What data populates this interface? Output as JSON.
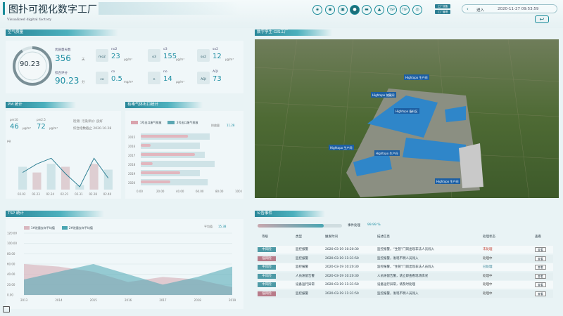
{
  "header": {
    "title": "图扑可视化数字工厂",
    "subtitle": "Visualized digital factory",
    "nav_icons": [
      "shield-icon",
      "camera-icon",
      "image-icon",
      "droplet-icon",
      "truck-icon",
      "factory-icon",
      "tsp-icon",
      "tsp2-icon",
      "layers-icon"
    ],
    "nav_texts": [
      "",
      "",
      "",
      "",
      "",
      "",
      "TSP",
      "TSP",
      ""
    ],
    "pill_top": "工厂设备",
    "pill_bottom": "工厂管理",
    "datebar_label": "进入",
    "datetime": "2020-11-27 09:53:59",
    "back_symbol": "↩"
  },
  "air_quality": {
    "panel_title": "空气质量",
    "gauge_value": "90.23",
    "excellent_days_label": "优质量天数",
    "excellent_days_value": "356",
    "excellent_days_unit": "天",
    "overall_label": "综合评分",
    "overall_value": "90.23",
    "overall_unit": "分",
    "items": [
      {
        "icon": "mo2",
        "name": "no2",
        "value": "23",
        "unit": "μg/m³"
      },
      {
        "icon": "o3",
        "name": "o3",
        "value": "155",
        "unit": "μg/m³"
      },
      {
        "icon": "so2",
        "name": "so2",
        "value": "12",
        "unit": "μg/m³"
      },
      {
        "icon": "co",
        "name": "co",
        "value": "0.5",
        "unit": "mg/m³"
      },
      {
        "icon": "n",
        "name": "no",
        "value": "14",
        "unit": "μg/m³"
      },
      {
        "icon": "AQI",
        "name": "AQI",
        "value": "73",
        "unit": ""
      }
    ]
  },
  "pm": {
    "panel_title": "PM 统计",
    "pm10_label": "pm10",
    "pm10_value": "46",
    "pm10_unit": "μg/m³",
    "pm25_label": "pm2.5",
    "pm25_value": "72",
    "pm25_unit": "μg/m³",
    "desc1": "检测: 污染评价: 良好",
    "desc2": "综合指数截止 2020.10.28",
    "ylabel": "μg"
  },
  "hazard": {
    "panel_title": "有毒气体出口统计",
    "legend1": "1号出口废气排放",
    "legend2": "2号出口废气排放",
    "value_label": "排放量",
    "value": "11.28"
  },
  "gis": {
    "panel_title": "数字孪生-GIS工厂",
    "labels": [
      "Hightopo 生产间",
      "Hightopo 储藏间",
      "Hightopo 备料区",
      "Hightopo 生产间",
      "Hightopo 生产间",
      "Hightopo 生产间"
    ]
  },
  "tsp": {
    "panel_title": "TSP 统计",
    "legend1": "1#进量去年平均值",
    "legend2": "2#进量去年平均值",
    "avg_label": "平均值",
    "avg_value": "15.38"
  },
  "events": {
    "panel_title": "公告事件",
    "progress_label": "事件处理",
    "progress_text": "99.99 %",
    "progress": 0.78,
    "columns": [
      "等级",
      "类型",
      "触发时间",
      "描述信息",
      "处理状态",
      "查看"
    ],
    "rows": [
      {
        "level": "中风险",
        "type": "监控报警",
        "time": "2020-03-19 10:20:30",
        "desc": "监控报警，“生管”门岗出现非法人员闯入",
        "status": "未处理",
        "btn": "查看"
      },
      {
        "level": "低风险",
        "type": "监控报警",
        "time": "2020-03-19 11:31:50",
        "desc": "监控报警，发现不明人员闯入",
        "status": "处理中",
        "btn": "查看"
      },
      {
        "level": "中风险",
        "type": "监控报警",
        "time": "2020-03-19 10:20:30",
        "desc": "监控报警，“生管”门岗出现非法人员闯入",
        "status": "已处理",
        "btn": "查看"
      },
      {
        "level": "中风险",
        "type": "人员滞留告警",
        "time": "2020-03-19 10:20:30",
        "desc": "人员滞留告警，请立即查看现场情况",
        "status": "处理中",
        "btn": "查看"
      },
      {
        "level": "中风险",
        "type": "设备运行异常",
        "time": "2020-03-19 11:31:50",
        "desc": "设备运行异常，请及时处理",
        "status": "处理中",
        "btn": "查看"
      },
      {
        "level": "低风险",
        "type": "监控报警",
        "time": "2020-03-19 11:31:50",
        "desc": "监控报警，发现不明人员闯入",
        "status": "处理中",
        "btn": "查看"
      }
    ]
  },
  "chart_data": [
    {
      "type": "bar",
      "title": "PM 统计",
      "categories": [
        "02.02",
        "02.23",
        "02.24",
        "02.21",
        "02.31",
        "02.28",
        "02.40"
      ],
      "series": [
        {
          "name": "bars",
          "values": [
            40,
            30,
            45,
            40,
            8,
            45,
            35
          ]
        },
        {
          "name": "line",
          "values": [
            30,
            45,
            55,
            28,
            5,
            55,
            20
          ]
        }
      ],
      "ylim": [
        0,
        80
      ]
    },
    {
      "type": "bar",
      "title": "有毒气体出口统计",
      "categories": [
        "2015",
        "2016",
        "2017",
        "2018",
        "2019",
        "2020"
      ],
      "series": [
        {
          "name": "1号出口废气排放",
          "values": [
            48,
            10,
            55,
            12,
            40,
            30
          ]
        },
        {
          "name": "2号出口废气排放",
          "values": [
            70,
            60,
            65,
            75,
            60,
            68
          ]
        }
      ],
      "xticks": [
        "0.00",
        "20.00",
        "40.00",
        "60.00",
        "80.00",
        "100.00"
      ],
      "xlim": [
        0,
        100
      ]
    },
    {
      "type": "area",
      "title": "TSP 统计",
      "categories": [
        "2013",
        "2014",
        "2015",
        "2016",
        "2017",
        "2018",
        "2019"
      ],
      "series": [
        {
          "name": "1#进量去年平均值",
          "values": [
            60,
            55,
            45,
            25,
            35,
            30,
            15
          ]
        },
        {
          "name": "2#进量去年平均值",
          "values": [
            30,
            45,
            60,
            40,
            20,
            35,
            55
          ]
        }
      ],
      "yticks": [
        "0.00",
        "20.00",
        "40.00",
        "60.00",
        "80.00",
        "100.00",
        "120.00"
      ],
      "ylim": [
        0,
        120
      ]
    }
  ]
}
